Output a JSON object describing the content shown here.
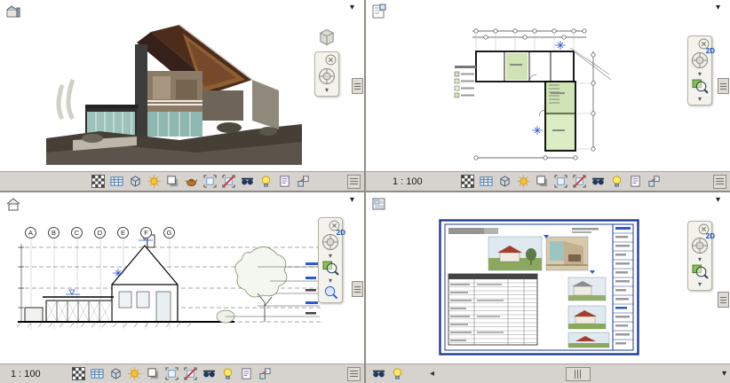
{
  "colors": {
    "chrome": "#d6d3ce",
    "chrome_border": "#a9a59b",
    "divider": "#8f8c84",
    "canvas": "#ffffff",
    "accent_blue": "#1550c0",
    "annotation_blue": "#2a5ad0",
    "room_green": "#cfe3b4",
    "roof_brown": "#4e2c1c",
    "sheet_border_blue": "#1d3c8f"
  },
  "viewports": {
    "view3d": {
      "scale_label": "",
      "nav_wheel_label": "",
      "toolbar_icons": [
        "scale",
        "detail-level",
        "visual-style",
        "sun",
        "shadows",
        "render",
        "crop",
        "crop-visibility",
        "hide-isolate",
        "reveal-hidden",
        "view-properties",
        "displacement"
      ]
    },
    "plan": {
      "scale_label": "1 : 100",
      "nav_wheel_label": "2D",
      "toolbar_icons": [
        "scale",
        "detail-level",
        "visual-style",
        "sun",
        "shadows",
        "crop",
        "crop-visibility",
        "hide-isolate",
        "reveal-hidden",
        "view-properties",
        "displacement"
      ]
    },
    "elevation": {
      "scale_label": "1 : 100",
      "nav_wheel_label": "2D",
      "grid_bubbles": [
        "A",
        "B",
        "C",
        "D",
        "E",
        "F",
        "G"
      ],
      "toolbar_icons": [
        "scale",
        "detail-level",
        "visual-style",
        "sun",
        "shadows",
        "crop",
        "crop-visibility",
        "hide-isolate",
        "reveal-hidden",
        "view-properties",
        "displacement"
      ]
    },
    "sheet": {
      "scale_label": "",
      "nav_wheel_label": "2D",
      "toolbar_icons": [
        "hide-isolate",
        "reveal-hidden"
      ]
    }
  }
}
